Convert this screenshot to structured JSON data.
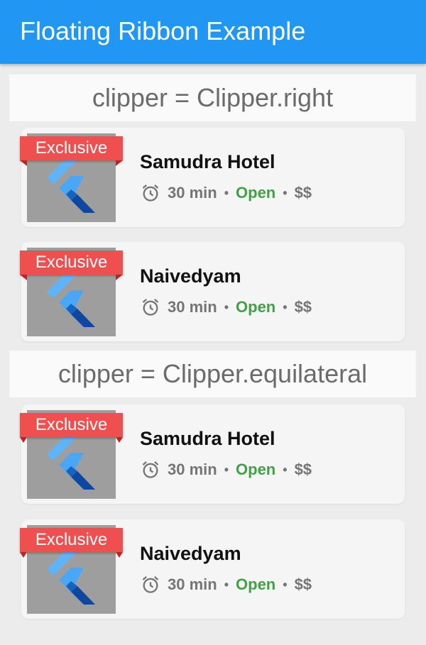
{
  "appbar": {
    "title": "Floating Ribbon Example"
  },
  "sections": [
    {
      "header": "clipper = Clipper.right",
      "cards": [
        {
          "ribbon": "Exclusive",
          "name": "Samudra Hotel",
          "time": "30 min",
          "status": "Open",
          "price": "$$"
        },
        {
          "ribbon": "Exclusive",
          "name": "Naivedyam",
          "time": "30 min",
          "status": "Open",
          "price": "$$"
        }
      ]
    },
    {
      "header": "clipper = Clipper.equilateral",
      "cards": [
        {
          "ribbon": "Exclusive",
          "name": "Samudra Hotel",
          "time": "30 min",
          "status": "Open",
          "price": "$$"
        },
        {
          "ribbon": "Exclusive",
          "name": "Naivedyam",
          "time": "30 min",
          "status": "Open",
          "price": "$$"
        }
      ]
    }
  ],
  "meta_separator": "•",
  "icons": {
    "clock": "alarm-clock-icon",
    "logo": "flutter-logo-icon"
  },
  "colors": {
    "appbar": "#2196f3",
    "ribbon": "#ef4f4f",
    "open": "#43a047"
  }
}
